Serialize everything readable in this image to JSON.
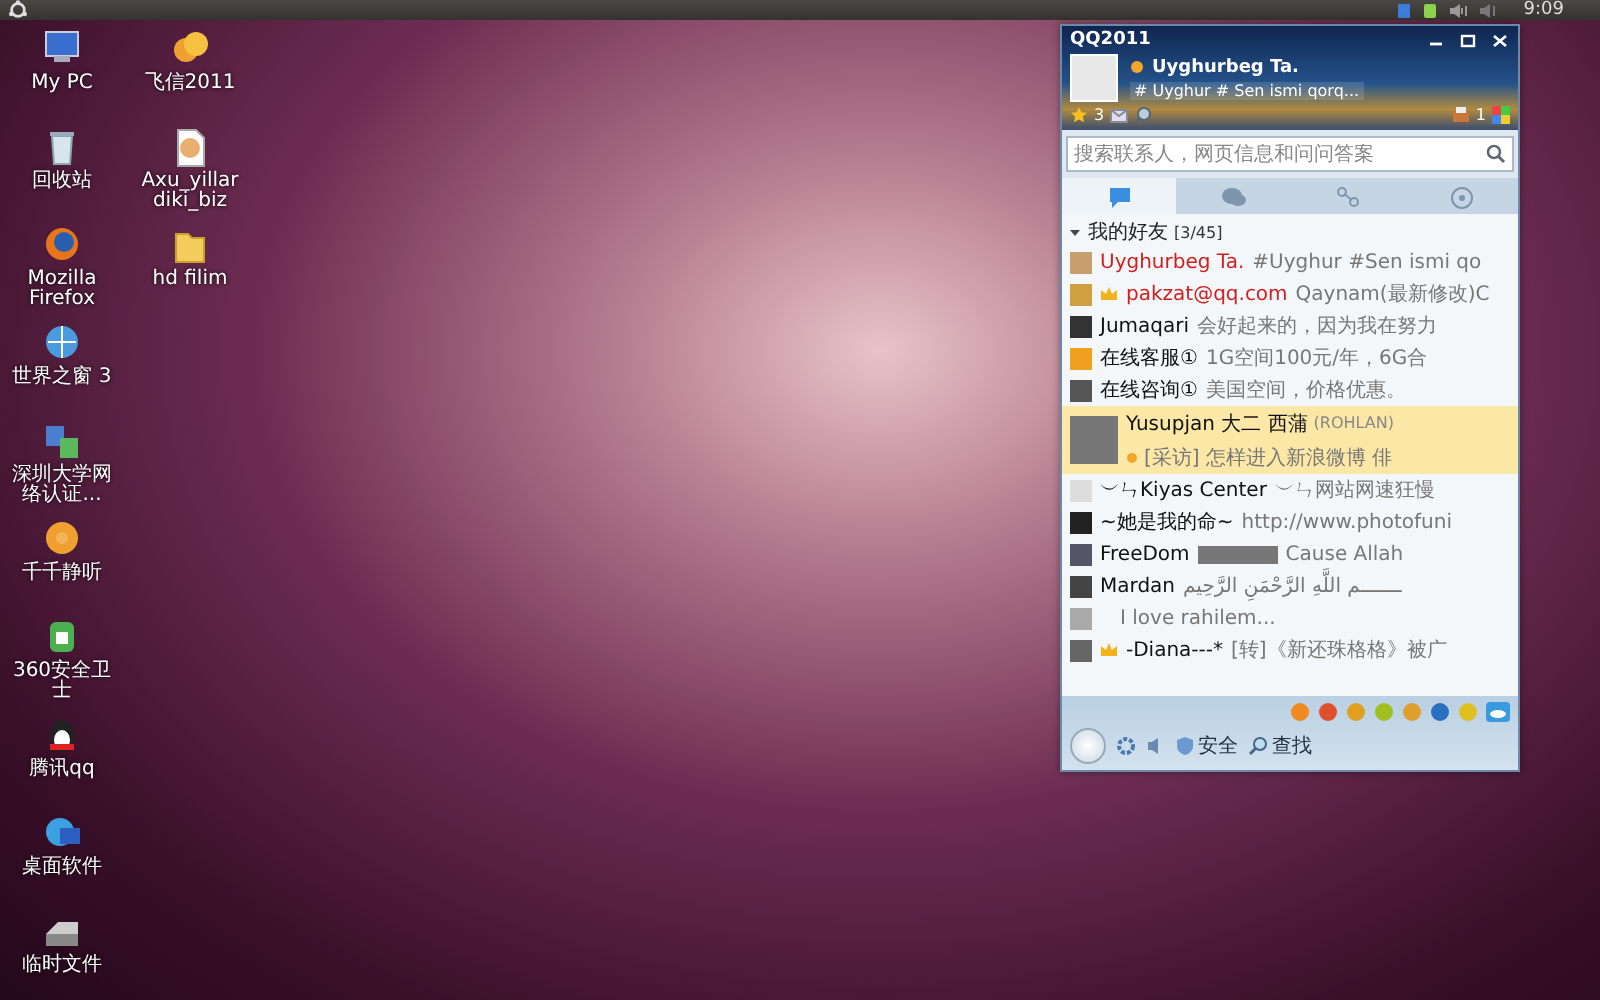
{
  "top_panel": {
    "clock": "9:09"
  },
  "desktop_icons": [
    {
      "label": "My PC"
    },
    {
      "label": "回收站"
    },
    {
      "label": "Mozilla Firefox"
    },
    {
      "label": "世界之窗 3"
    },
    {
      "label": "深圳大学网络认证..."
    },
    {
      "label": "千千静听"
    },
    {
      "label": "360安全卫士"
    },
    {
      "label": "腾讯qq"
    },
    {
      "label": "桌面软件"
    },
    {
      "label": "临时文件"
    },
    {
      "label": "飞信2011"
    },
    {
      "label": "Axu_yillar diki_biz"
    },
    {
      "label": "hd filim"
    }
  ],
  "qq_window": {
    "title": "QQ2011",
    "nickname": "Uyghurbeg Ta.",
    "signature": "# Uyghur # Sen ismi qorq...",
    "star_count": "3",
    "mail_count": "1",
    "search": {
      "placeholder": "搜索联系人，网页信息和问问答案"
    },
    "tabs": [
      {
        "selected": true
      },
      {
        "selected": false
      },
      {
        "selected": false
      },
      {
        "selected": false
      }
    ],
    "group": {
      "label": "我的好友",
      "count": "[3/45]",
      "expanded": true
    },
    "friends": [
      {
        "name": "Uyghurbeg Ta.",
        "signature": "#Uyghur #Sen ismi qo",
        "highlighted": true,
        "crown": false,
        "selected": false
      },
      {
        "name": "pakzat@qq.com",
        "signature": "Qaynam(最新修改)C",
        "highlighted": true,
        "crown": true,
        "selected": false
      },
      {
        "name": "Jumaqari",
        "signature": "会好起来的，因为我在努力",
        "highlighted": false,
        "crown": false,
        "selected": false
      },
      {
        "name": "在线客服①",
        "signature": "1G空间100元/年，6G合",
        "highlighted": false,
        "crown": false,
        "selected": false
      },
      {
        "name": "在线咨询①",
        "signature": "美国空间，价格优惠。",
        "highlighted": false,
        "crown": false,
        "selected": false
      },
      {
        "name": "Yusupjan 大二 西蒲",
        "remark": "(ROHLAN)",
        "signature": "[采访] 怎样进入新浪微博  俳",
        "highlighted": false,
        "crown": false,
        "selected": true
      },
      {
        "name": "︶ㄣKiyas Center",
        "signature": "︶ㄣ网站网速狂慢",
        "highlighted": false,
        "crown": false,
        "selected": false
      },
      {
        "name": "~她是我的命~",
        "signature": "http://www.photofuni",
        "highlighted": false,
        "crown": false,
        "selected": false
      },
      {
        "name": "FreeDom",
        "signature": "Cause Allah",
        "redacted": true,
        "highlighted": false,
        "crown": false,
        "selected": false
      },
      {
        "name": "Mardan",
        "signature": "ـــــــم اللَّهِ الرَّحْمَنِ الرَّحِيم",
        "highlighted": false,
        "crown": false,
        "selected": false
      },
      {
        "signature": "I love rahilem...",
        "crown": false,
        "selected": false
      },
      {
        "name": "-Diana---*",
        "signature": "[转]《新还珠格格》被广",
        "highlighted": false,
        "crown": true,
        "selected": false
      }
    ],
    "toolbar": {
      "security_label": "安全",
      "find_label": "查找"
    }
  }
}
